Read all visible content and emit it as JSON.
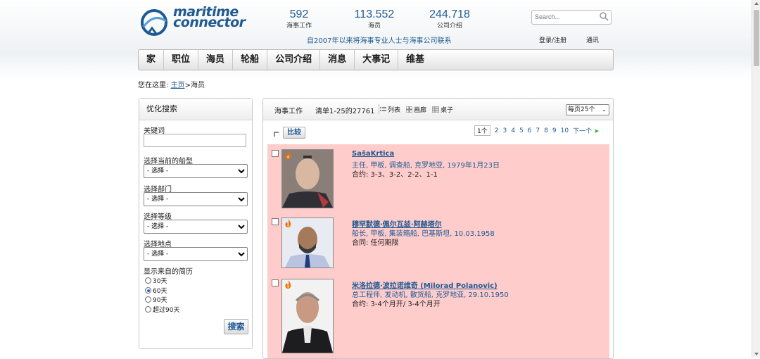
{
  "logo": {
    "line1": "maritime",
    "line2": "connector"
  },
  "stats": [
    {
      "num": "592",
      "label": "海事工作"
    },
    {
      "num": "113.552",
      "label": "海员"
    },
    {
      "num": "244.718",
      "label": "公司介绍"
    }
  ],
  "tagline": "自2007年以来将海事专业人士与海事公司联系",
  "search": {
    "placeholder": "Search..."
  },
  "toplinks": {
    "login": "登录/注册",
    "contact": "通讯"
  },
  "nav": [
    "家",
    "职位",
    "海员",
    "轮船",
    "公司介绍",
    "消息",
    "大事记",
    "维基"
  ],
  "breadcrumb": {
    "prefix": "您在这里:",
    "home": "主页",
    "current": ">海员"
  },
  "filter": {
    "title": "优化搜索",
    "keyword_label": "关键词",
    "ship_type_label": "选择当前的船型",
    "department_label": "选择部门",
    "rank_label": "选择等级",
    "location_label": "选择地点",
    "select_placeholder": "- 选择 -",
    "cv_label": "显示来自的简历",
    "cv_options": [
      "30天",
      "60天",
      "90天",
      "超过90天"
    ],
    "cv_selected": "60天",
    "search_button": "搜索"
  },
  "results": {
    "tab_label": "海事工作",
    "count_text": "清单1-25的27761",
    "views": [
      "列表",
      "画廊",
      "桌子"
    ],
    "per_page": "每页25个",
    "compare_button": "比较",
    "pager": {
      "current": "1个",
      "pages": [
        "2",
        "3",
        "4",
        "5",
        "6",
        "7",
        "8",
        "9",
        "10"
      ],
      "next": "下一个"
    },
    "items": [
      {
        "name": "SašaKrtica",
        "details": "主任, 甲板, 调查船, 克罗地亚, 1979年1月23日",
        "contract": "合约: 3-3、3-2、2-2、1-1"
      },
      {
        "name": "穆罕默德·佩尔瓦兹·阿赫塔尔",
        "details": "船长, 甲板, 集装箱船, 巴基斯坦, 10.03.1958",
        "contract": "合同: 任何期限"
      },
      {
        "name": "米洛拉德·波拉诺维奇 (Milorad Polanovic)",
        "details": "总工程师, 发动机, 散货船, 克罗地亚, 29.10.1950",
        "contract": "合约: 3-4个月开/ 3-4个月开"
      }
    ]
  }
}
